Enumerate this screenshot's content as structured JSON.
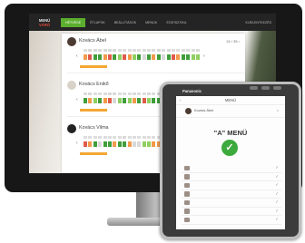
{
  "monitor": {
    "logo_lines": [
      "MENÜ",
      "VÁRÓ"
    ],
    "nav": [
      "HÉTVÉGE",
      "ÉTLAPOK",
      "BEÁLLÍTÁSOK",
      "MENÜK",
      "STATISZTIKA"
    ],
    "nav_right": "KIJELENTKEZÉS",
    "persons": [
      {
        "name": "Kovács Ábel",
        "meta": "24 / 35 ›"
      },
      {
        "name": "Kovács Enikő",
        "meta": ""
      },
      {
        "name": "Kovács Vilma",
        "meta": ""
      }
    ]
  },
  "tablet": {
    "brand": "Panasonic",
    "title": "MENÜ",
    "back": "‹",
    "person": "Kovács Ábel",
    "menu_title": "\"A\" MENÜ",
    "check": "✓",
    "row_check": "✓"
  },
  "colors": {
    "green": "#3f9e3a",
    "lightgreen": "#8fcf62",
    "orange": "#f29a4a",
    "red": "#e05a4a",
    "grey": "#d9d9d9"
  }
}
